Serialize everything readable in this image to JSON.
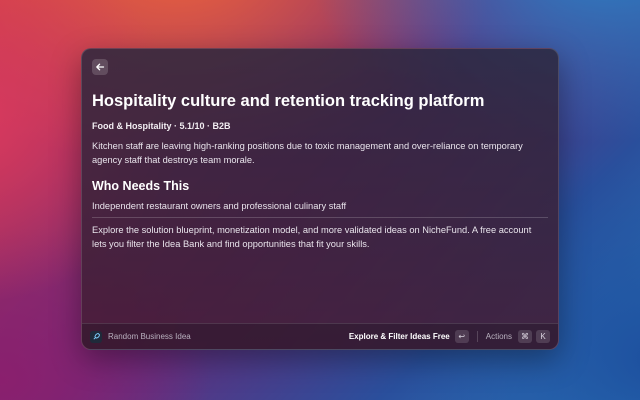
{
  "window": {
    "back_icon": "arrow-left-icon"
  },
  "idea": {
    "title": "Hospitality culture and retention tracking platform",
    "meta": "Food & Hospitality · 5.1/10 · B2B",
    "description": "Kitchen staff are leaving high-ranking positions due to toxic management and over-reliance on temporary agency staff that destroys team morale.",
    "who_heading": "Who Needs This",
    "who_text": "Independent restaurant owners and professional culinary staff",
    "promo": "Explore the solution blueprint, monetization model, and more validated ideas on NicheFund. A free account lets you filter the Idea Bank and find opportunities that fit your skills."
  },
  "footer": {
    "app_icon": "rocket-icon",
    "app_name": "Random Business Idea",
    "primary_action": "Explore & Filter Ideas Free",
    "primary_key": "↩",
    "actions_label": "Actions",
    "actions_key_1": "⌘",
    "actions_key_2": "K"
  }
}
